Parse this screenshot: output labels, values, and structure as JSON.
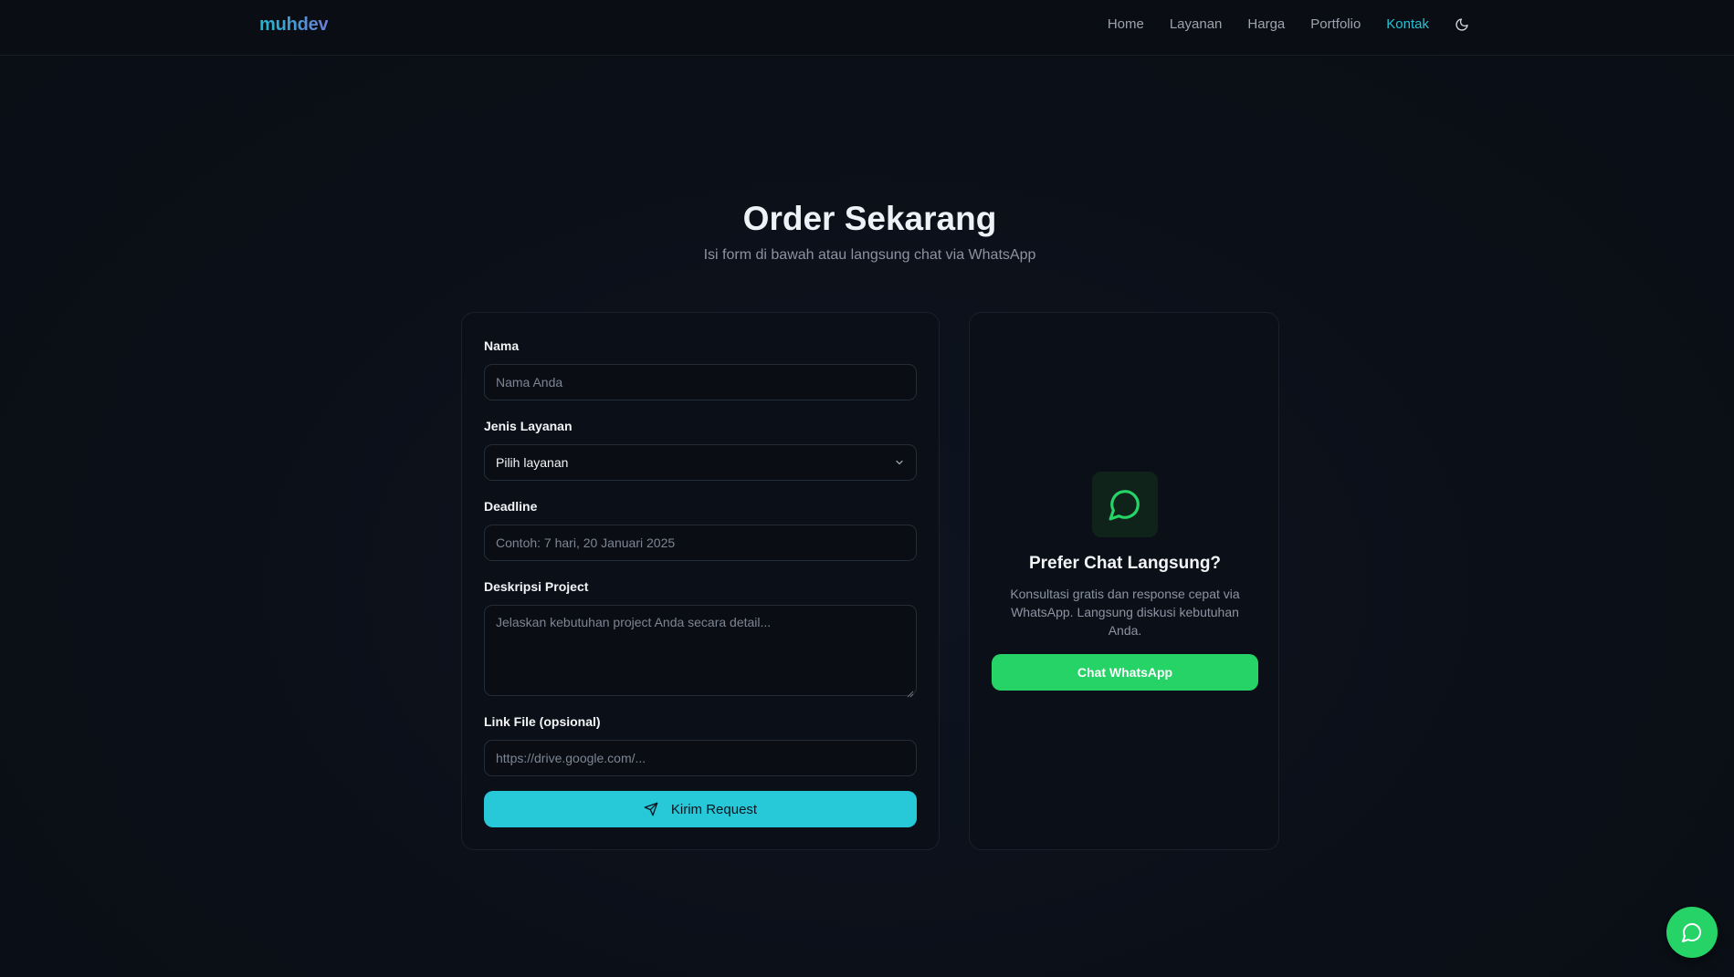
{
  "header": {
    "logo": "muhdev",
    "nav": [
      "Home",
      "Layanan",
      "Harga",
      "Portfolio",
      "Kontak"
    ],
    "active": "Kontak",
    "theme_icon": "moon-icon"
  },
  "hero": {
    "title": "Order Sekarang",
    "subtitle": "Isi form di bawah atau langsung chat via WhatsApp"
  },
  "form": {
    "name_label": "Nama",
    "name_placeholder": "Nama Anda",
    "service_label": "Jenis Layanan",
    "service_value": "Pilih layanan",
    "deadline_label": "Deadline",
    "deadline_placeholder": "Contoh: 7 hari, 20 Januari 2025",
    "description_label": "Deskripsi Project",
    "description_placeholder": "Jelaskan kebutuhan project Anda secara detail...",
    "link_label": "Link File (opsional)",
    "link_placeholder": "https://drive.google.com/...",
    "submit_label": "Kirim Request"
  },
  "whatsapp_card": {
    "title": "Prefer Chat Langsung?",
    "description": "Konsultasi gratis dan response cepat via WhatsApp. Langsung diskusi kebutuhan Anda.",
    "button_label": "Chat WhatsApp",
    "icon": "whatsapp-chat-icon"
  },
  "colors": {
    "accent": "#27c9d8",
    "whatsapp": "#25d366",
    "background": "#0b0f17"
  }
}
